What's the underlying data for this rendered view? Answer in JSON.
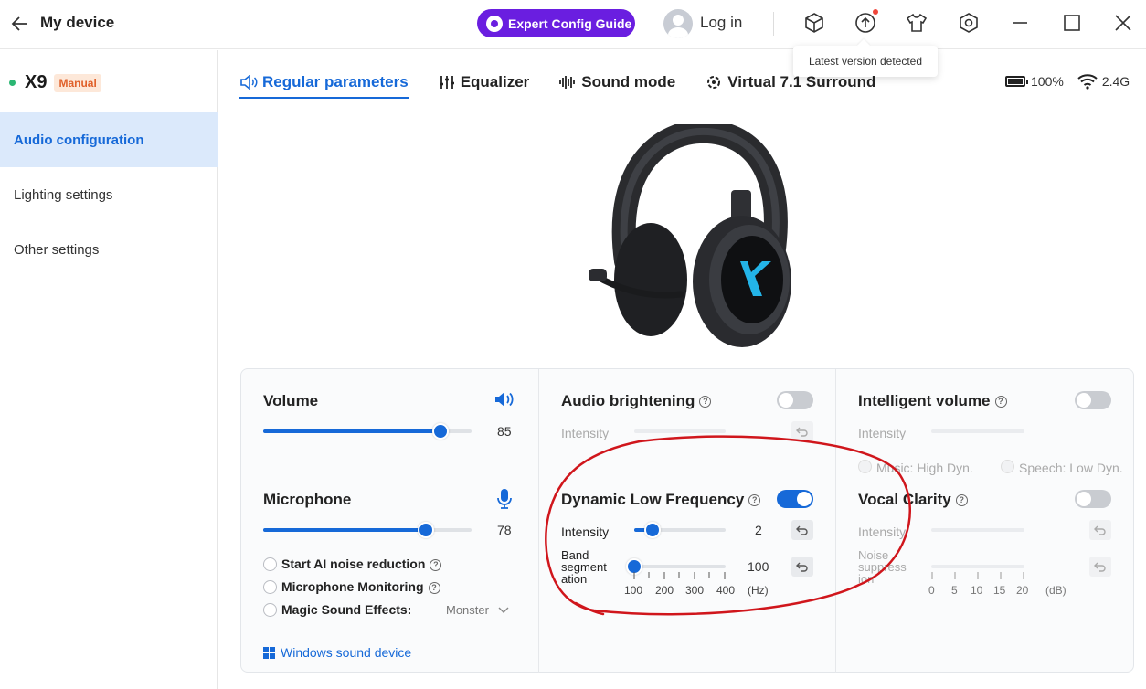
{
  "header": {
    "title": "My device",
    "guide_label": "Expert Config Guide",
    "login_label": "Log in",
    "tooltip": "Latest version detected"
  },
  "sidebar": {
    "device_name": "X9",
    "device_badge": "Manual",
    "items": [
      {
        "label": "Audio configuration",
        "active": true
      },
      {
        "label": "Lighting settings",
        "active": false
      },
      {
        "label": "Other settings",
        "active": false
      }
    ]
  },
  "tabs": [
    {
      "label": "Regular parameters",
      "active": true
    },
    {
      "label": "Equalizer",
      "active": false
    },
    {
      "label": "Sound mode",
      "active": false
    },
    {
      "label": "Virtual 7.1 Surround",
      "active": false
    }
  ],
  "status": {
    "battery": "100%",
    "wireless": "2.4G"
  },
  "volume": {
    "label": "Volume",
    "value": "85",
    "level": 0.85
  },
  "microphone": {
    "label": "Microphone",
    "value": "78",
    "level": 0.78,
    "options": [
      {
        "label": "Start AI noise reduction",
        "help": true
      },
      {
        "label": "Microphone Monitoring",
        "help": true
      },
      {
        "label": "Magic Sound Effects:",
        "help": false
      }
    ],
    "effect_value": "Monster",
    "windows_link": "Windows sound device"
  },
  "audio_brightening": {
    "label": "Audio brightening",
    "enabled": false,
    "intensity_label": "Intensity"
  },
  "dynamic_low_frequency": {
    "label": "Dynamic Low Frequency",
    "enabled": true,
    "intensity_label": "Intensity",
    "intensity_value": "2",
    "intensity_level": 0.2,
    "band_label": "Band segment ation",
    "band_value": "100",
    "band_level": 0,
    "band_ticks": [
      "100",
      "200",
      "300",
      "400"
    ],
    "band_unit": "(Hz)"
  },
  "intelligent_volume": {
    "label": "Intelligent volume",
    "enabled": false,
    "intensity_label": "Intensity",
    "mode_music": "Music: High Dyn.",
    "mode_speech": "Speech: Low Dyn."
  },
  "vocal_clarity": {
    "label": "Vocal Clarity",
    "enabled": false,
    "intensity_label": "Intensity",
    "noise_label": "Noise suppress ion",
    "noise_ticks": [
      "0",
      "5",
      "10",
      "15",
      "20"
    ],
    "noise_unit": "(dB)"
  },
  "colors": {
    "accent": "#1669d8",
    "guide": "#6a1ee0",
    "annotation": "#d0161c",
    "online": "#2bb673"
  }
}
